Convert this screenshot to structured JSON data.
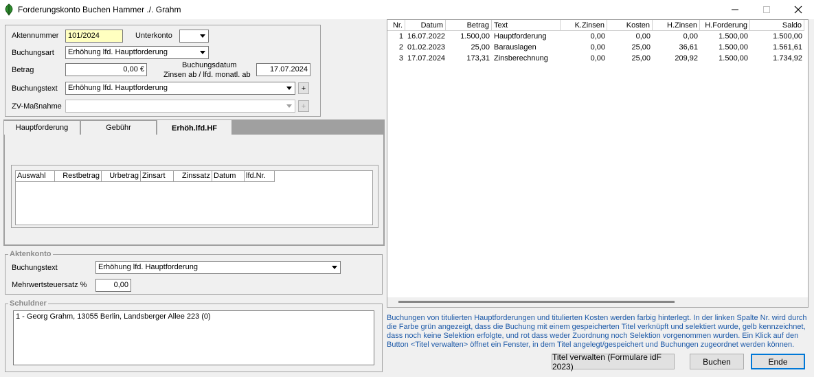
{
  "window": {
    "title": "Forderungskonto Buchen Hammer ./. Grahm",
    "icon": "leaf-app-icon",
    "controls": [
      "minimize-icon",
      "maximize-icon",
      "close-icon"
    ]
  },
  "form": {
    "aktennummer_label": "Aktennummer",
    "aktennummer_value": "101/2024",
    "unterkonto_label": "Unterkonto",
    "unterkonto_value": "",
    "buchungsart_label": "Buchungsart",
    "buchungsart_value": "Erhöhung lfd. Hauptforderung",
    "betrag_label": "Betrag",
    "betrag_value": "0,00 €",
    "buchungsdatum_label": "Buchungsdatum",
    "zinsen_label": "Zinsen ab / lfd. monatl. ab",
    "buchungsdatum_value": "17.07.2024",
    "buchungstext_label": "Buchungstext",
    "buchungstext_value": "Erhöhung lfd. Hauptforderung",
    "zv_label": "ZV-Maßnahme",
    "zv_value": "",
    "plus_label": "+"
  },
  "tabs": [
    {
      "label": "Hauptforderung",
      "active": false
    },
    {
      "label": "Gebühr",
      "active": false
    },
    {
      "label": "Erhöh.lfd.HF",
      "active": true
    }
  ],
  "subgrid": {
    "columns": [
      "Auswahl",
      "Restbetrag",
      "Urbetrag",
      "Zinsart",
      "Zinssatz",
      "Datum",
      "lfd.Nr."
    ]
  },
  "aktenkonto": {
    "caption": "Aktenkonto",
    "buchungstext_label": "Buchungstext",
    "buchungstext_value": "Erhöhung lfd. Hauptforderung",
    "mwst_label": "Mehrwertsteuersatz %",
    "mwst_value": "0,00"
  },
  "schuldner": {
    "caption": "Schuldner",
    "entries": [
      "1 - Georg Grahm, 13055 Berlin, Landsberger Allee 223 (0)"
    ]
  },
  "ledger": {
    "columns": [
      "Nr.",
      "Datum",
      "Betrag",
      "Text",
      "K.Zinsen",
      "Kosten",
      "H.Zinsen",
      "H.Forderung",
      "Saldo"
    ],
    "rows": [
      [
        "1",
        "16.07.2022",
        "1.500,00",
        "Hauptforderung",
        "0,00",
        "0,00",
        "0,00",
        "1.500,00",
        "1.500,00"
      ],
      [
        "2",
        "01.02.2023",
        "25,00",
        "Barauslagen",
        "0,00",
        "25,00",
        "36,61",
        "1.500,00",
        "1.561,61"
      ],
      [
        "3",
        "17.07.2024",
        "173,31",
        "Zinsberechnung",
        "0,00",
        "25,00",
        "209,92",
        "1.500,00",
        "1.734,92"
      ]
    ]
  },
  "info_text": "Buchungen von titulierten Hauptforderungen und titulierten Kosten werden farbig hinterlegt. In der linken Spalte Nr. wird durch die Farbe grün angezeigt, dass die Buchung mit einem gespeicherten Titel verknüpft und selektiert wurde, gelb kennzeichnet, dass noch keine Selektion erfolgte, und rot dass weder Zuordnung noch Selektion vorgenommen wurden. Ein Klick auf den Button <Titel verwalten> öffnet ein Fenster, in dem Titel angelegt/gespeichert und Buchungen zugeordnet werden können.",
  "buttons": {
    "titel": "Titel verwalten (Formulare idF 2023)",
    "buchen": "Buchen",
    "ende": "Ende"
  },
  "colors": {
    "accent": "#0078d7",
    "info_text": "#1e5aa8",
    "yellow_field": "#ffffc0"
  }
}
